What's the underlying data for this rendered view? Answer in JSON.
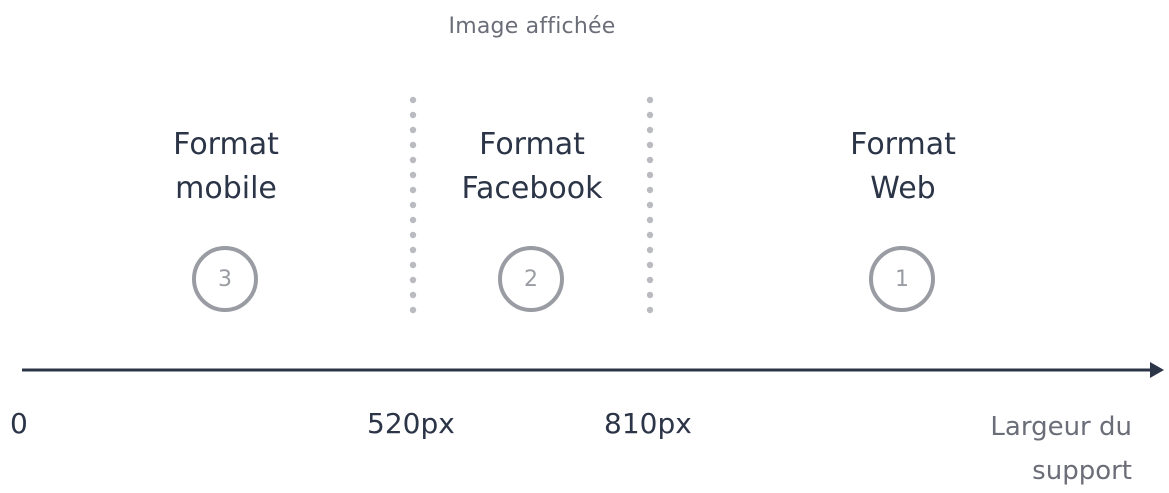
{
  "diagram": {
    "title": "Image affichée",
    "zones": [
      {
        "label_line1": "Format",
        "label_line2": "mobile",
        "badge": "3"
      },
      {
        "label_line1": "Format",
        "label_line2": "Facebook",
        "badge": "2"
      },
      {
        "label_line1": "Format",
        "label_line2": "Web",
        "badge": "1"
      }
    ],
    "axis": {
      "ticks": [
        "0",
        "520px",
        "810px"
      ],
      "title_line1": "Largeur du",
      "title_line2": "support"
    },
    "colors": {
      "text_dark": "#2b3547",
      "text_muted": "#6b6e78",
      "badge": "#9a9ca3",
      "divider": "#b9bbc0",
      "axis": "#2b3547"
    }
  }
}
